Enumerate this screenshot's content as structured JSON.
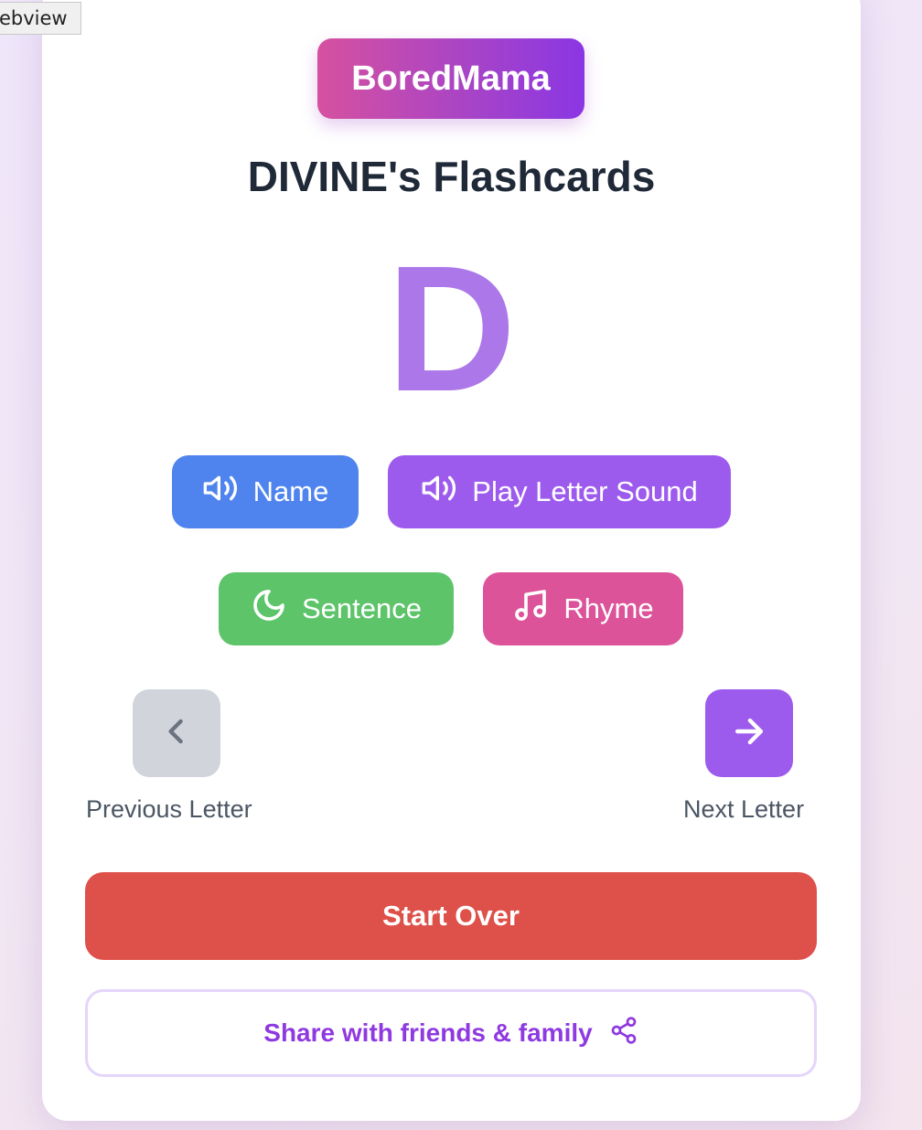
{
  "tooltip": {
    "text": "ebview"
  },
  "brand": {
    "name": "BoredMama"
  },
  "page": {
    "title": "DIVINE's Flashcards"
  },
  "flashcard": {
    "letter": "D"
  },
  "actions": {
    "name_label": "Name",
    "sound_label": "Play Letter Sound",
    "sentence_label": "Sentence",
    "rhyme_label": "Rhyme"
  },
  "nav": {
    "prev_label": "Previous Letter",
    "next_label": "Next Letter"
  },
  "footer": {
    "start_over_label": "Start Over",
    "share_label": "Share with friends & family"
  },
  "icons": {
    "name": "speaker-icon",
    "sound": "speaker-icon",
    "sentence": "moon-icon",
    "rhyme": "music-note-icon",
    "prev": "chevron-left-icon",
    "next": "arrow-right-icon",
    "share": "share-icon"
  },
  "colors": {
    "brand_start": "#d6519f",
    "brand_end": "#8a36e3",
    "letter": "#ac77e8",
    "name_button": "#4f84ee",
    "sound_button": "#9d5bee",
    "sentence_button": "#5dc46a",
    "rhyme_button": "#dc5399",
    "start_over": "#de514a",
    "share_text": "#8f39e0"
  }
}
